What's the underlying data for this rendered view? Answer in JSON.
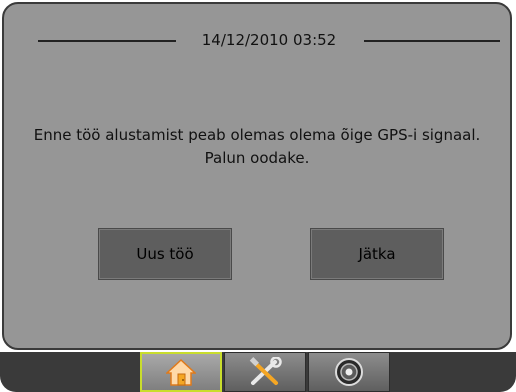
{
  "header": {
    "datetime": "14/12/2010 03:52"
  },
  "message": {
    "line1": "Enne töö alustamist peab olemas olema õige GPS-i signaal.",
    "line2": "Palun oodake."
  },
  "buttons": {
    "new_job": "Uus töö",
    "continue": "Jätka"
  },
  "tabs": [
    {
      "icon": "home-icon",
      "active": true
    },
    {
      "icon": "tools-icon",
      "active": false
    },
    {
      "icon": "gauge-icon",
      "active": false
    }
  ],
  "colors": {
    "panel_bg": "#969696",
    "button_bg": "#5e5e5e",
    "active_tab_border": "#c9dd2c",
    "home_icon": "#f5a623"
  }
}
